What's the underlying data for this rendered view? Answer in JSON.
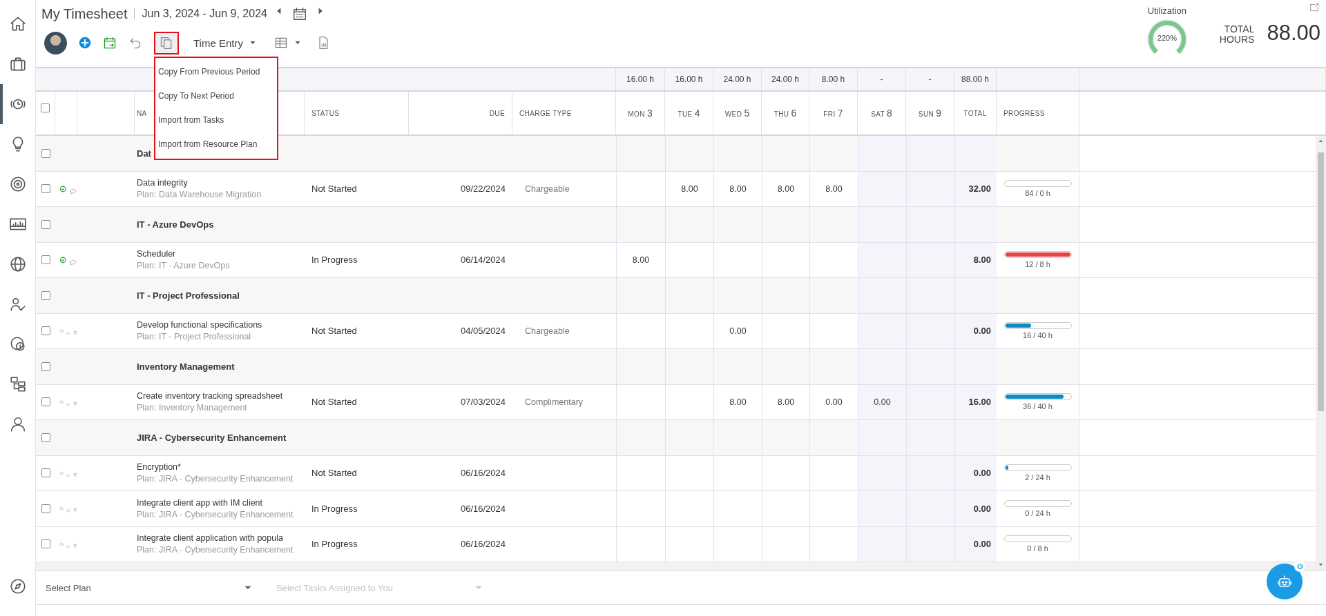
{
  "sidebar": {
    "items": [
      {
        "kind": "home",
        "selected": false
      },
      {
        "kind": "briefcase",
        "selected": false
      },
      {
        "kind": "clock",
        "selected": true
      },
      {
        "kind": "bulb",
        "selected": false
      },
      {
        "kind": "target",
        "selected": false
      },
      {
        "kind": "chart",
        "selected": false
      },
      {
        "kind": "globe",
        "selected": false
      },
      {
        "kind": "people",
        "selected": false
      },
      {
        "kind": "coins",
        "selected": false
      },
      {
        "kind": "hierarchy",
        "selected": false
      },
      {
        "kind": "person",
        "selected": false
      }
    ],
    "bottom_item": {
      "kind": "compass",
      "selected": false
    }
  },
  "header": {
    "title": "My Timesheet",
    "period": "Jun 3, 2024 - Jun 9, 2024",
    "utilization": {
      "label": "Utilization",
      "value": "220%",
      "level": 1
    },
    "total_hours": {
      "label": "TOTAL HOURS",
      "value": "88.00"
    }
  },
  "toolbar": {
    "view": "Time Entry",
    "copy_menu": {
      "open": true,
      "items": [
        "Copy From Previous Period",
        "Copy To Next Period",
        "Import from Tasks",
        "Import from Resource Plan"
      ]
    }
  },
  "summary": {
    "day_totals": [
      "16.00 h",
      "16.00 h",
      "24.00 h",
      "24.00 h",
      "8.00 h",
      "-",
      "-"
    ],
    "total": "88.00 h"
  },
  "table": {
    "select_all": {
      "checked": false
    },
    "columns": [
      {
        "kind": "text",
        "label": "NA"
      },
      {
        "kind": "text",
        "label": "STATUS"
      },
      {
        "kind": "date",
        "label": "DUE"
      },
      {
        "kind": "text",
        "label": "CHARGE TYPE"
      },
      {
        "kind": "day",
        "label": "MON",
        "date": "3"
      },
      {
        "kind": "day",
        "label": "TUE",
        "date": "4"
      },
      {
        "kind": "day",
        "label": "WED",
        "date": "5"
      },
      {
        "kind": "day",
        "label": "THU",
        "date": "6"
      },
      {
        "kind": "day",
        "label": "FRI",
        "date": "7"
      },
      {
        "kind": "weekend",
        "label": "SAT",
        "date": "8"
      },
      {
        "kind": "weekend",
        "label": "SUN",
        "date": "9"
      },
      {
        "kind": "total",
        "label": "TOTAL"
      },
      {
        "kind": "progress",
        "label": "PROGRESS"
      }
    ],
    "rows": [
      {
        "kind": "group",
        "checked": false,
        "name": "Dat"
      },
      {
        "kind": "task",
        "checked": false,
        "completed": true,
        "name": "Data integrity",
        "plan": "Plan: Data Warehouse Migration",
        "status": "Not Started",
        "due": "09/22/2024",
        "charge_type": "Chargeable",
        "hours": {
          "day_2": "8.00",
          "day_3": "8.00",
          "day_4": "8.00",
          "day_5": "8.00"
        },
        "total": "32.00",
        "progress": {
          "label": "84 / 0 h",
          "level": 0
        }
      },
      {
        "kind": "group",
        "checked": false,
        "name": "IT - Azure DevOps"
      },
      {
        "kind": "task",
        "checked": false,
        "completed": true,
        "name": "Scheduler",
        "plan": "Plan: IT - Azure DevOps",
        "status": "In Progress",
        "due": "06/14/2024",
        "hours": {
          "day_1": "8.00"
        },
        "total": "8.00",
        "progress": {
          "label": "12 / 8 h",
          "level": 1,
          "color": "#e84242"
        }
      },
      {
        "kind": "group",
        "checked": false,
        "name": "IT - Project Professional"
      },
      {
        "kind": "task",
        "checked": false,
        "completed": false,
        "name": "Develop functional specifications",
        "plan": "Plan: IT - Project Professional",
        "status": "Not Started",
        "due": "04/05/2024",
        "charge_type": "Chargeable",
        "hours": {
          "day_3": "0.00"
        },
        "total": "0.00",
        "progress": {
          "label": "16 / 40 h",
          "level": 0.4,
          "color": "#0a8bc4"
        }
      },
      {
        "kind": "group",
        "checked": false,
        "name": "Inventory Management"
      },
      {
        "kind": "task",
        "checked": false,
        "completed": false,
        "name": "Create inventory tracking spreadsheet",
        "plan": "Plan: Inventory Management",
        "status": "Not Started",
        "due": "07/03/2024",
        "charge_type": "Complimentary",
        "hours": {
          "day_3": "8.00",
          "day_4": "8.00",
          "day_5": "0.00",
          "day_6": "0.00"
        },
        "total": "16.00",
        "progress": {
          "label": "36 / 40 h",
          "level": 0.9,
          "color": "#0a8bc4"
        }
      },
      {
        "kind": "group",
        "checked": false,
        "name": "JIRA - Cybersecurity Enhancement"
      },
      {
        "kind": "task",
        "checked": false,
        "completed": false,
        "name": "Encryption*",
        "plan": "Plan: JIRA - Cybersecurity Enhancement",
        "status": "Not Started",
        "due": "06/16/2024",
        "total": "0.00",
        "progress": {
          "label": "2 / 24 h",
          "level": 0.05,
          "color": "#0a8bc4"
        }
      },
      {
        "kind": "task",
        "checked": false,
        "completed": false,
        "name": "Integrate client app with IM client",
        "plan": "Plan: JIRA - Cybersecurity Enhancement",
        "status": "In Progress",
        "due": "06/16/2024",
        "total": "0.00",
        "progress": {
          "label": "0 / 24 h",
          "level": 0
        }
      },
      {
        "kind": "task",
        "checked": false,
        "completed": false,
        "name": "Integrate client application with popula",
        "plan": "Plan: JIRA - Cybersecurity Enhancement",
        "status": "In Progress",
        "due": "06/16/2024",
        "total": "0.00",
        "progress": {
          "label": "0 / 8 h",
          "level": 0
        }
      }
    ]
  },
  "footer": {
    "plan_select": {
      "placeholder": "Select Plan",
      "disabled": false
    },
    "task_select": {
      "placeholder": "Select Tasks Assigned to You",
      "disabled": true
    }
  }
}
